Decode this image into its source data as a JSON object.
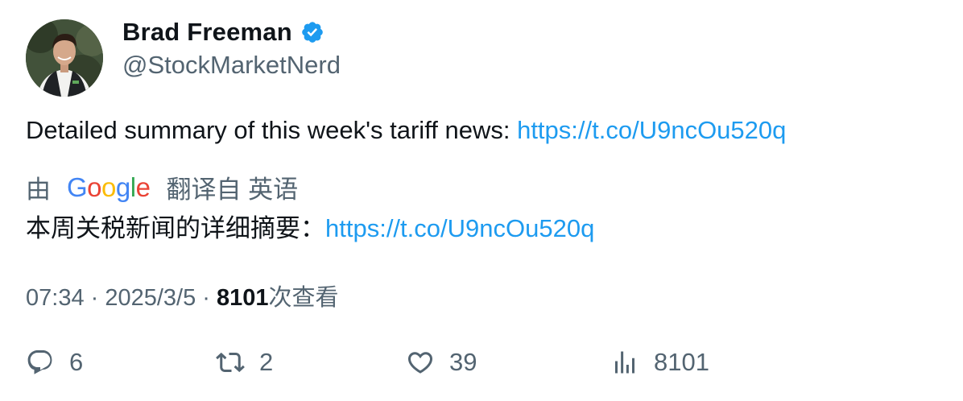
{
  "author": {
    "name": "Brad Freeman",
    "handle": "@StockMarketNerd",
    "verified": true,
    "verified_icon": "verified-badge-icon",
    "verified_color": "#1d9bf0"
  },
  "tweet": {
    "text": "Detailed summary of this week's tariff news: ",
    "link": "https://t.co/U9ncOu520q"
  },
  "translation": {
    "prefix": "由",
    "provider": "Google",
    "suffix": "翻译自 英语",
    "text": "本周关税新闻的详细摘要：",
    "link": "https://t.co/U9ncOu520q"
  },
  "meta": {
    "time": "07:34",
    "date": "2025/3/5",
    "views": "8101",
    "views_label": "次查看",
    "separator": " · "
  },
  "actions": {
    "reply": {
      "icon": "reply-icon",
      "count": "6"
    },
    "retweet": {
      "icon": "retweet-icon",
      "count": "2"
    },
    "like": {
      "icon": "heart-icon",
      "count": "39"
    },
    "views": {
      "icon": "analytics-icon",
      "count": "8101"
    }
  },
  "colors": {
    "link": "#1d9bf0",
    "secondary_text": "#536471",
    "primary_text": "#0f1419"
  }
}
